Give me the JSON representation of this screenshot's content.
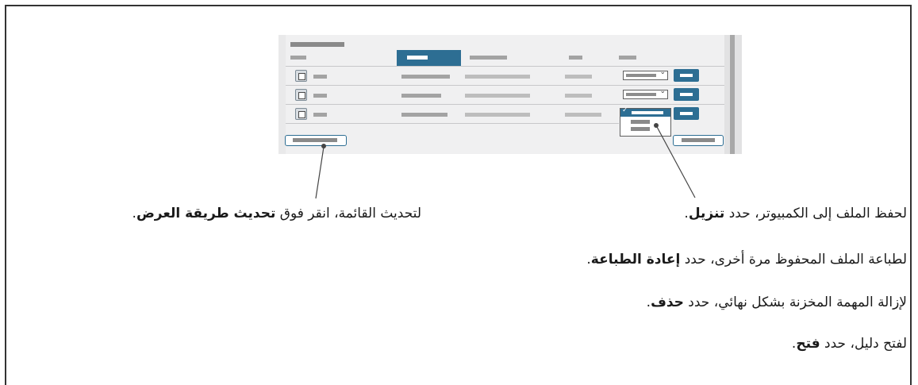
{
  "callouts": {
    "refresh": {
      "pre": "لتحديث القائمة، انقر فوق ",
      "bold": "تحديث طريقة العرض",
      "post": "."
    },
    "download": {
      "pre": "لحفظ الملف إلى الكمبيوتر، حدد ",
      "bold": "تنزيل",
      "post": "."
    },
    "reprint": {
      "pre": "لطباعة الملف المحفوظ مرة أخرى، حدد ",
      "bold": "إعادة الطباعة",
      "post": "."
    },
    "delete": {
      "pre": "لإزالة المهمة المخزنة بشكل نهائي، حدد ",
      "bold": "حذف",
      "post": "."
    },
    "open": {
      "pre": "لفتح دليل، حدد ",
      "bold": "فتح",
      "post": "."
    }
  },
  "mock_ui": {
    "rows": 3,
    "dropdown_open_on_row": 3,
    "accent_color": "#2d6e93"
  }
}
